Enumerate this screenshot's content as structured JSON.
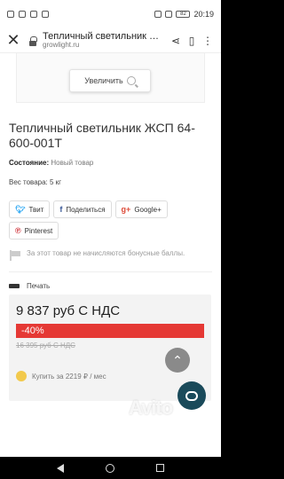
{
  "statusbar": {
    "time": "20:19",
    "battery": "82"
  },
  "browser": {
    "tab_title": "Тепличный светильник ЖСП 64-600-001Т",
    "domain": "growlight.ru"
  },
  "image_area": {
    "zoom_label": "Увеличить"
  },
  "product": {
    "title": "Тепличный светильник ЖСП 64-600-001Т",
    "condition_label": "Состояние:",
    "condition_value": "Новый товар",
    "weight": "Вес товара: 5 кг"
  },
  "share": {
    "twitter": "Твит",
    "facebook": "Поделиться",
    "google": "Google+",
    "pinterest": "Pinterest"
  },
  "bonus_text": "За этот товар не начисляются бонусные баллы.",
  "print_label": "Печать",
  "price": {
    "current": "9 837 руб С НДС",
    "discount": "-40%",
    "old": "16 395 руб С НДС",
    "credit": "Купить за 2219 ₽ / мес"
  },
  "watermark": "Avito",
  "colors": {
    "discount_bg": "#e53935",
    "chat_bg": "#1a4a5a",
    "price_bg": "#f3f3f3"
  }
}
